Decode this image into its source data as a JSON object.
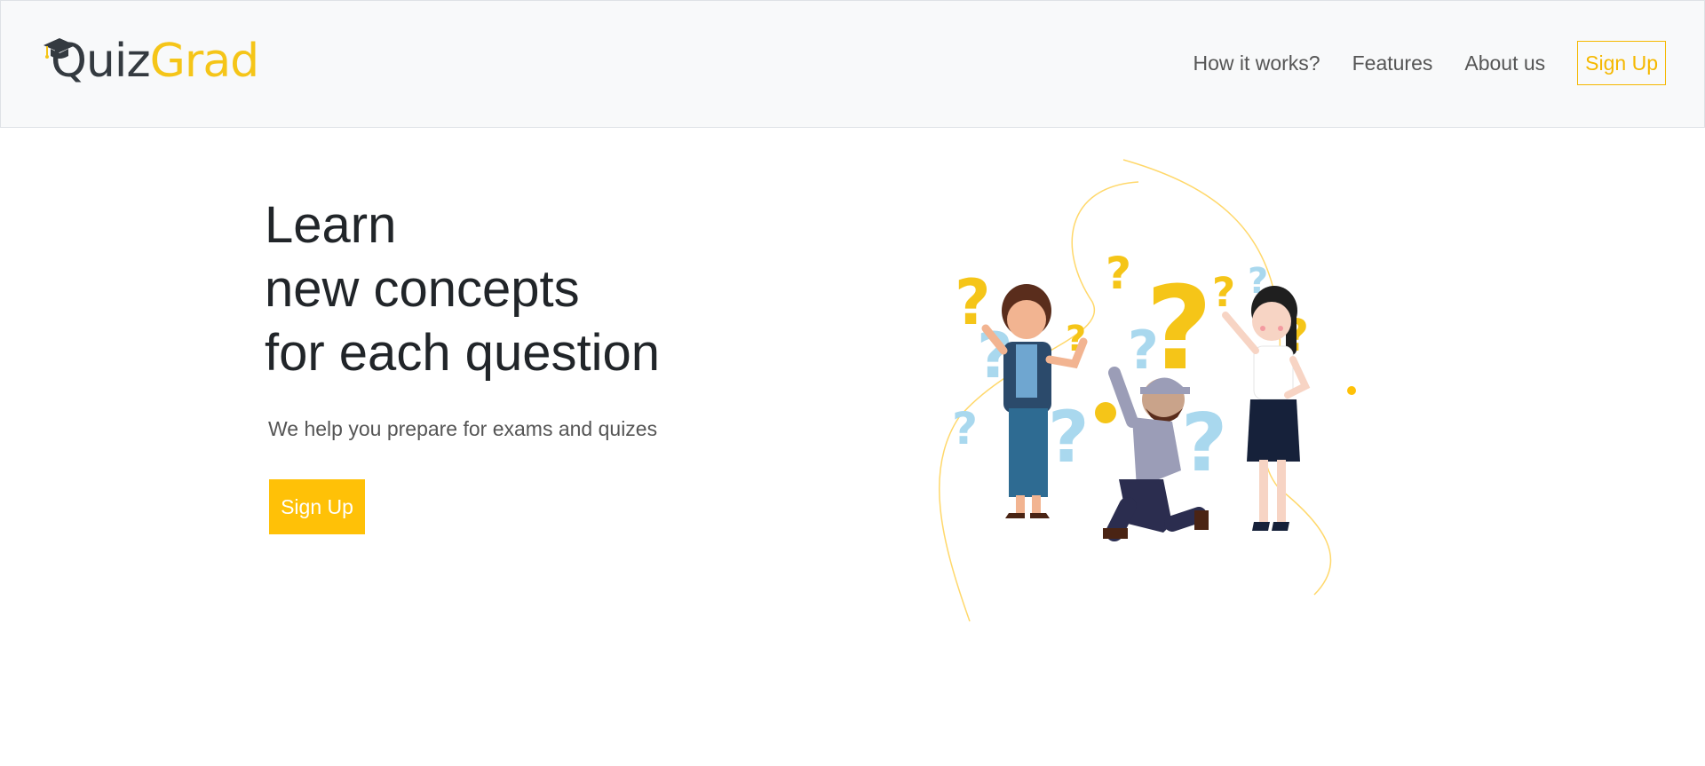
{
  "brand": {
    "name_part1": "Quiz",
    "name_part2": "Grad",
    "accent_color": "#f5c518",
    "icon": "graduation-cap-icon"
  },
  "nav": {
    "links": [
      {
        "label": "How it works?"
      },
      {
        "label": "Features"
      },
      {
        "label": "About us"
      }
    ],
    "signup_label": "Sign Up"
  },
  "hero": {
    "title_lines": [
      "Learn",
      "new concepts",
      "for each question"
    ],
    "subtitle": "We help you prepare for exams and quizes",
    "cta_label": "Sign Up",
    "cta_color": "#ffc107"
  },
  "illustration": {
    "description_icon": "people-with-question-marks-illustration"
  }
}
